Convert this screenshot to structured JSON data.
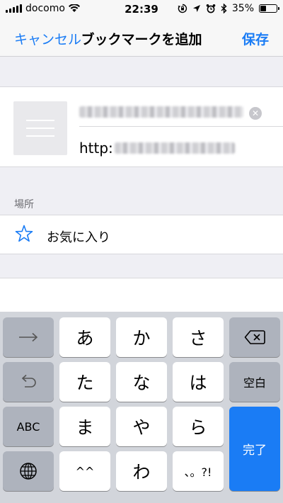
{
  "status_bar": {
    "carrier": "docomo",
    "time": "22:39",
    "battery": "35%",
    "battery_level": 0.35,
    "icons": [
      "signal-icon",
      "wifi-icon",
      "screen-rotation-lock-icon",
      "location-icon",
      "alarm-icon",
      "bluetooth-icon",
      "battery-icon"
    ]
  },
  "nav": {
    "cancel": "キャンセル",
    "title": "ブックマークを追加",
    "save": "保存",
    "accent_color": "#1a7cf5"
  },
  "bookmark": {
    "url_prefix": "http:"
  },
  "location": {
    "section_label": "場所",
    "folder_name": "お気に入り",
    "icon": "star-icon"
  },
  "keyboard": {
    "keys": [
      {
        "label": "",
        "icon": "arrow-right-icon"
      },
      {
        "label": "あ"
      },
      {
        "label": "か"
      },
      {
        "label": "さ"
      },
      {
        "label": "",
        "icon": "backspace-icon"
      },
      {
        "label": "",
        "icon": "undo-icon"
      },
      {
        "label": "た"
      },
      {
        "label": "な"
      },
      {
        "label": "は"
      },
      {
        "label": "空白"
      },
      {
        "label": "ABC"
      },
      {
        "label": "ま"
      },
      {
        "label": "や"
      },
      {
        "label": "ら"
      },
      {
        "label": "完了"
      },
      {
        "label": "",
        "icon": "globe-icon"
      },
      {
        "label": "^^"
      },
      {
        "label": "わ"
      },
      {
        "label": "、。?!"
      }
    ]
  }
}
